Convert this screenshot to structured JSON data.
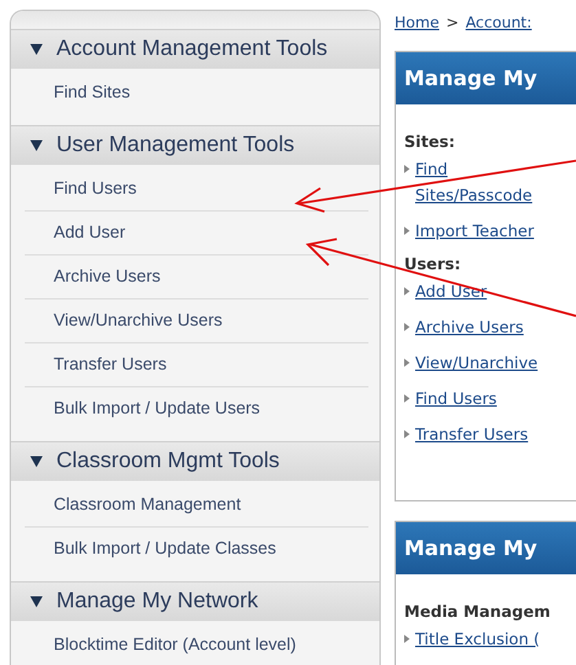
{
  "sidebar": {
    "sections": [
      {
        "title": "Account Management Tools",
        "expanded": true,
        "items": [
          "Find Sites"
        ]
      },
      {
        "title": "User Management Tools",
        "expanded": true,
        "items": [
          "Find Users",
          "Add User",
          "Archive Users",
          "View/Unarchive Users",
          "Transfer Users",
          "Bulk Import / Update Users"
        ]
      },
      {
        "title": "Classroom Mgmt Tools",
        "expanded": true,
        "items": [
          "Classroom Management",
          "Bulk Import / Update Classes"
        ]
      },
      {
        "title": "Manage My Network",
        "expanded": true,
        "items": [
          "Blocktime Editor (Account level)"
        ]
      }
    ]
  },
  "breadcrumb": [
    "Home",
    "Account:"
  ],
  "breadcrumb_separator": ">",
  "panels": [
    {
      "title": "Manage My",
      "groups": [
        {
          "heading": "Sites:",
          "links": [
            "Find Sites/Passcode",
            "Import Teacher"
          ]
        },
        {
          "heading": "Users:",
          "links": [
            "Add User",
            "Archive Users",
            "View/Unarchive",
            "Find Users",
            "Transfer Users"
          ]
        }
      ]
    },
    {
      "title": "Manage My",
      "groups": [
        {
          "heading": "Media Managem",
          "links": [
            "Title Exclusion ("
          ]
        }
      ]
    }
  ]
}
